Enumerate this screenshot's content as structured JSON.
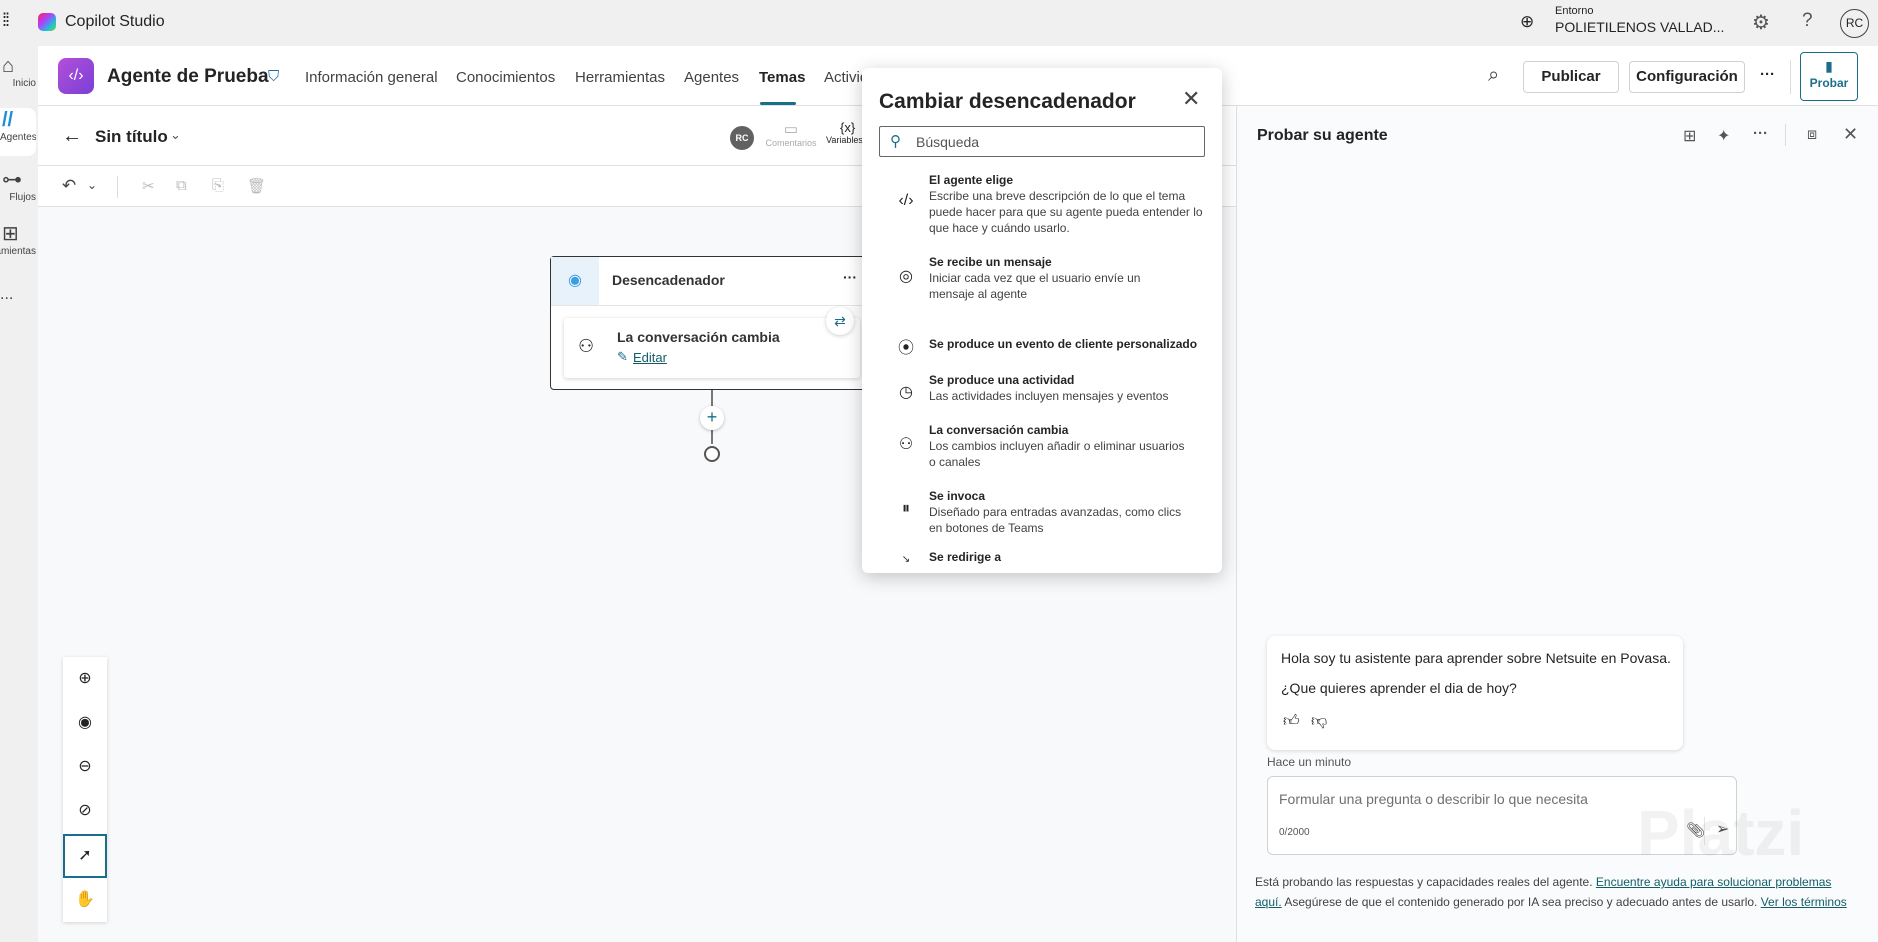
{
  "app": {
    "title": "Copilot Studio",
    "env_label": "Entorno",
    "env_name": "POLIETILENOS VALLAD...",
    "user_initials": "RC"
  },
  "rail": [
    {
      "label": "Inicio",
      "icon": "home-icon"
    },
    {
      "label": "Agentes",
      "icon": "agents-icon"
    },
    {
      "label": "Flujos",
      "icon": "flows-icon"
    },
    {
      "label": "Herramientas",
      "icon": "tools-icon"
    },
    {
      "label": "...",
      "icon": "more-icon"
    }
  ],
  "agent": {
    "name": "Agente de Prueba"
  },
  "tabs": [
    "Información general",
    "Conocimientos",
    "Herramientas",
    "Agentes",
    "Temas",
    "Activid"
  ],
  "active_tab": "Temas",
  "actions": {
    "publish": "Publicar",
    "settings": "Configuración",
    "more": "···",
    "test": "Probar"
  },
  "topic": {
    "title": "Sin título",
    "avatar": "RC",
    "comments": "Comentarios",
    "variables": "Variables"
  },
  "canvas": {
    "node_title": "Desencadenador",
    "node_more": "···",
    "trigger_name": "La conversación cambia",
    "edit_label": "Editar"
  },
  "popup": {
    "title": "Cambiar desencadenador",
    "search_placeholder": "Búsqueda",
    "options": [
      {
        "title": "El agente elige",
        "desc": "Escribe una breve descripción de lo que el tema puede hacer para que su agente pueda entender lo que hace y cuándo usarlo.",
        "icon": "agent-code-icon"
      },
      {
        "title": "Se recibe un mensaje",
        "desc": "Iniciar cada vez que el usuario envíe un mensaje al agente",
        "icon": "message-target-icon"
      },
      {
        "title": "Se produce un evento de cliente personalizado",
        "desc": "",
        "icon": "broadcast-icon"
      },
      {
        "title": "Se produce una actividad",
        "desc": "Las actividades incluyen mensajes y eventos",
        "icon": "clock-icon"
      },
      {
        "title": "La conversación cambia",
        "desc": "Los cambios incluyen añadir o eliminar usuarios o canales",
        "icon": "person-change-icon"
      },
      {
        "title": "Se invoca",
        "desc": "Diseñado para entradas avanzadas, como clics en botones de Teams",
        "icon": "pause-circle-icon"
      },
      {
        "title": "Se redirige a",
        "desc": "",
        "icon": "redirect-icon"
      }
    ]
  },
  "test_panel": {
    "title": "Probar su agente",
    "message_line1": "Hola soy tu asistente para aprender sobre Netsuite en Povasa.",
    "message_line2": "¿Que quieres aprender el dia de hoy?",
    "timestamp": "Hace un minuto",
    "input_placeholder": "Formular una pregunta o describir lo que necesita",
    "char_count": "0/2000",
    "disclaimer_1": "Está probando las respuestas y capacidades reales del agente. ",
    "disclaimer_link1": "Encuentre ayuda para solucionar problemas aquí.",
    "disclaimer_2": " Asegúrese de que el contenido generado por IA sea preciso y adecuado antes de usarlo. ",
    "disclaimer_link2": "Ver los términos"
  },
  "watermark": "Platzi"
}
